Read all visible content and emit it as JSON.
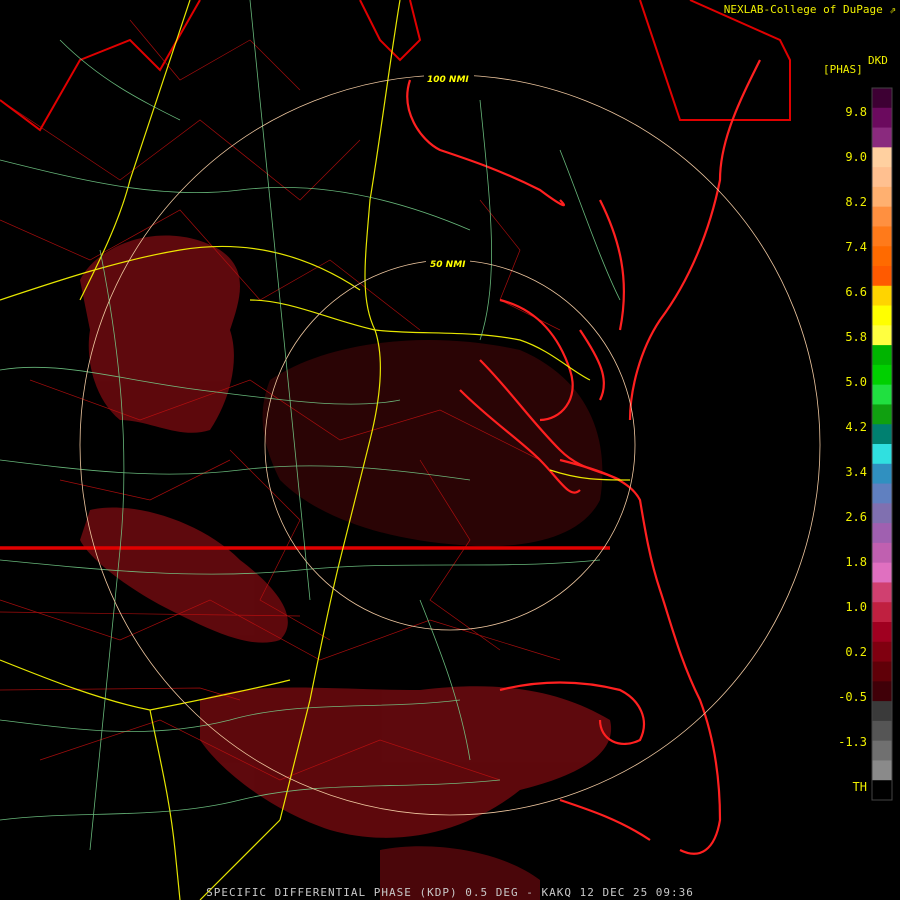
{
  "credit": "NEXLAB-College of DuPage",
  "legend": {
    "unit": "[PHAS]",
    "code": "DKD",
    "ticks": [
      "9.8",
      "9.0",
      "8.2",
      "7.4",
      "6.6",
      "5.8",
      "5.0",
      "4.2",
      "3.4",
      "2.6",
      "1.8",
      "1.0",
      "0.2",
      "-0.5",
      "-1.3",
      "TH"
    ],
    "colors": [
      "#3d0033",
      "#6b0a5e",
      "#8a2a7e",
      "#ffd0a0",
      "#ffc090",
      "#ffb070",
      "#ff9040",
      "#ff7a1a",
      "#ff6a00",
      "#ff5a00",
      "#ffd400",
      "#ffff00",
      "#ffff40",
      "#00b400",
      "#00d000",
      "#20e040",
      "#10a010",
      "#008070",
      "#30e0e0",
      "#3090c0",
      "#6080c0",
      "#8070b0",
      "#a060b0",
      "#c060b0",
      "#e070c0",
      "#d04070",
      "#c02040",
      "#a00020",
      "#800010",
      "#600008",
      "#400008",
      "#3a3a3a",
      "#555",
      "#707070",
      "#8a8a8a",
      "#000"
    ]
  },
  "rings": {
    "inner": "50 NMI",
    "outer": "100 NMI"
  },
  "footer": "SPECIFIC DIFFERENTIAL PHASE (KDP) 0.5 DEG - KAKQ 12 DEC 25 09:36"
}
